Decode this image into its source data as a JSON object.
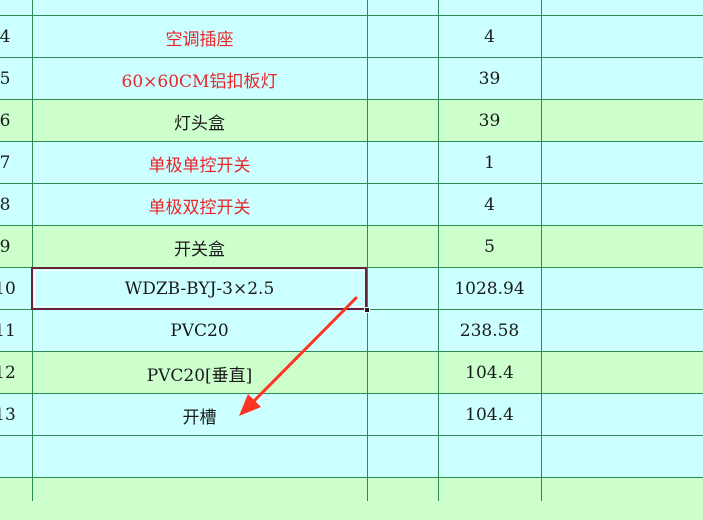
{
  "colors": {
    "green_row": "#ccffcc",
    "cyan_row": "#ccffff",
    "grid": "#2e8a53",
    "red_text": "#e8262a",
    "selection_border": "#6b2236",
    "annotation_arrow": "#ff3322"
  },
  "selected_cell": {
    "row_index": 7
  },
  "rows": [
    {
      "index": "",
      "name": "",
      "qty": "",
      "fill": "cyan",
      "red": false
    },
    {
      "index": "4",
      "name": "空调插座",
      "qty": "4",
      "fill": "cyan",
      "red": true
    },
    {
      "index": "5",
      "name": "60×60CM铝扣板灯",
      "qty": "39",
      "fill": "cyan",
      "red": true
    },
    {
      "index": "6",
      "name": "灯头盒",
      "qty": "39",
      "fill": "green",
      "red": false
    },
    {
      "index": "7",
      "name": "单极单控开关",
      "qty": "1",
      "fill": "cyan",
      "red": true
    },
    {
      "index": "8",
      "name": "单极双控开关",
      "qty": "4",
      "fill": "cyan",
      "red": true
    },
    {
      "index": "9",
      "name": "开关盒",
      "qty": "5",
      "fill": "green",
      "red": false
    },
    {
      "index": "10",
      "name": "WDZB-BYJ-3×2.5",
      "qty": "1028.94",
      "fill": "cyan",
      "red": false
    },
    {
      "index": "11",
      "name": "PVC20",
      "qty": "238.58",
      "fill": "cyan",
      "red": false
    },
    {
      "index": "12",
      "name": "PVC20[垂直]",
      "qty": "104.4",
      "fill": "green",
      "red": false
    },
    {
      "index": "13",
      "name": "开槽",
      "qty": "104.4",
      "fill": "cyan",
      "red": false
    },
    {
      "index": "",
      "name": "",
      "qty": "",
      "fill": "cyan",
      "red": false
    },
    {
      "index": "",
      "name": "",
      "qty": "",
      "fill": "green",
      "red": false
    }
  ]
}
